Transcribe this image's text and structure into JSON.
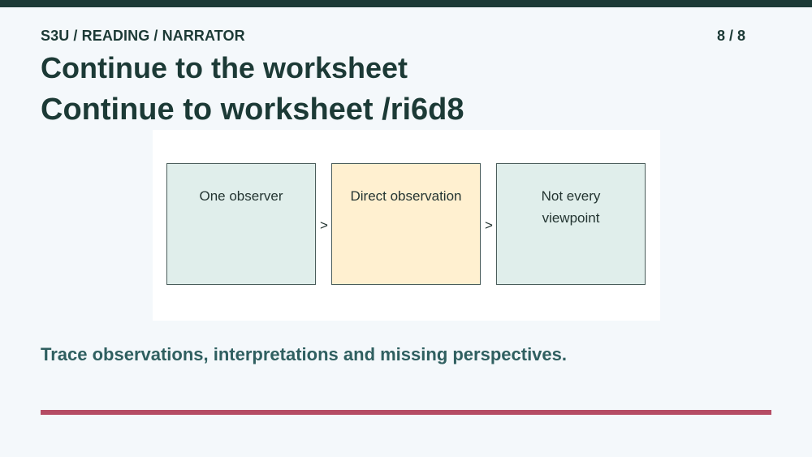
{
  "header": {
    "breadcrumb": "S3U / READING / NARRATOR",
    "page_counter": "8 / 8",
    "title": "Continue to the worksheet",
    "subtitle": "Continue to worksheet /ri6d8"
  },
  "diagram": {
    "steps": [
      {
        "lines": [
          "One observer"
        ]
      },
      {
        "lines": [
          "Direct observation"
        ]
      },
      {
        "lines": [
          "Not every",
          "viewpoint"
        ]
      }
    ],
    "connector": ">"
  },
  "footer": {
    "caption": "Trace observations, interpretations and missing perspectives."
  },
  "colors": {
    "top_bar": "#1c3a36",
    "box_neutral": "#e0eeeb",
    "box_highlight": "#fff0d0",
    "accent_rule": "#b54c64",
    "caption_text": "#2f5f60"
  }
}
